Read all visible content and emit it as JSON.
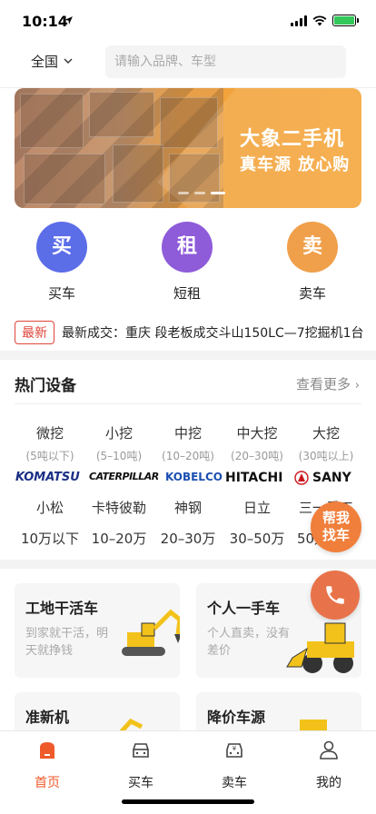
{
  "status_bar": {
    "time": "10:14"
  },
  "header": {
    "region": "全国",
    "search_placeholder": "请输入品牌、车型"
  },
  "banner": {
    "title": "大象二手机",
    "subtitle": "真车源  放心购"
  },
  "quick_entries": [
    {
      "icon_char": "买",
      "label": "买车",
      "color": "#5c6de8"
    },
    {
      "icon_char": "租",
      "label": "短租",
      "color": "#8e5bd9"
    },
    {
      "icon_char": "卖",
      "label": "卖车",
      "color": "#f0a04a"
    }
  ],
  "news": {
    "tag": "最新",
    "text": "最新成交：重庆 段老板成交斗山150LC—7挖掘机1台"
  },
  "hot": {
    "title": "热门设备",
    "more": "查看更多",
    "tonnage": [
      {
        "name": "微挖",
        "range": "(5吨以下)"
      },
      {
        "name": "小挖",
        "range": "(5–10吨)"
      },
      {
        "name": "中挖",
        "range": "(10–20吨)"
      },
      {
        "name": "中大挖",
        "range": "(20–30吨)"
      },
      {
        "name": "大挖",
        "range": "(30吨以上)"
      }
    ],
    "brands": [
      {
        "logo": "KOMATSU",
        "name": "小松",
        "color": "#1a2f86"
      },
      {
        "logo": "CATERPILLAR",
        "name": "卡特彼勒",
        "color": "#111111"
      },
      {
        "logo": "KOBELCO",
        "name": "神钢",
        "color": "#1c4fb0"
      },
      {
        "logo": "HITACHI",
        "name": "日立",
        "color": "#111111"
      },
      {
        "logo": "SANY",
        "name": "三一重工",
        "color": "#111111"
      }
    ],
    "prices": [
      "10万以下",
      "10–20万",
      "20–30万",
      "30–50万",
      "50万以上"
    ]
  },
  "fab": {
    "help_line1": "帮我",
    "help_line2": "找车"
  },
  "cards": [
    {
      "title": "工地干活车",
      "desc": "到家就干活，明天就挣钱"
    },
    {
      "title": "个人一手车",
      "desc": "个人直卖，没有差价"
    },
    {
      "title": "准新机",
      "desc": ""
    },
    {
      "title": "降价车源",
      "desc": ""
    }
  ],
  "tabs": [
    {
      "label": "首页",
      "icon": "home-icon"
    },
    {
      "label": "买车",
      "icon": "car-icon"
    },
    {
      "label": "卖车",
      "icon": "sell-car-icon"
    },
    {
      "label": "我的",
      "icon": "profile-icon"
    }
  ],
  "colors": {
    "accent": "#ef5a2b",
    "banner": "#f5a53a"
  }
}
